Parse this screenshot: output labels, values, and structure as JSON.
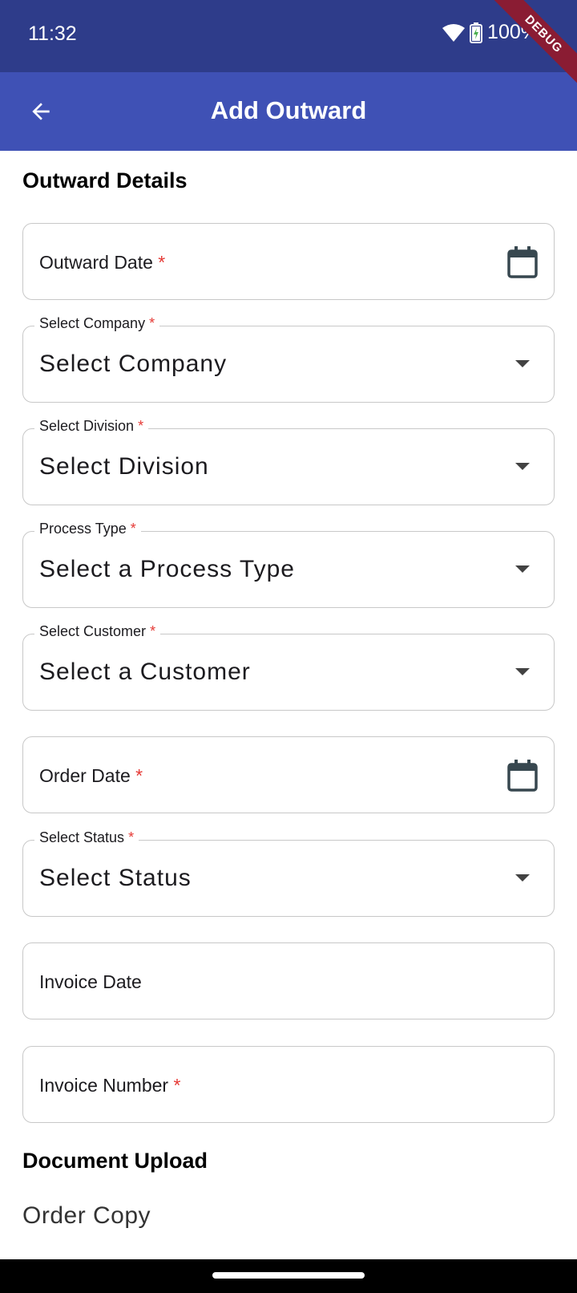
{
  "status_bar": {
    "time": "11:32",
    "battery": "100%"
  },
  "debug_ribbon": "DEBUG",
  "app_bar": {
    "title": "Add Outward"
  },
  "sections": {
    "outward_details": "Outward Details",
    "document_upload": "Document Upload"
  },
  "required_mark": "*",
  "fields": {
    "outward_date": {
      "label": "Outward Date"
    },
    "company": {
      "label": "Select Company",
      "placeholder": "Select Company"
    },
    "division": {
      "label": "Select Division",
      "placeholder": "Select Division"
    },
    "process_type": {
      "label": "Process Type",
      "placeholder": "Select a Process Type"
    },
    "customer": {
      "label": "Select Customer",
      "placeholder": "Select a Customer"
    },
    "order_date": {
      "label": "Order Date"
    },
    "status": {
      "label": "Select Status",
      "placeholder": "Select Status"
    },
    "invoice_date": {
      "label": "Invoice Date"
    },
    "invoice_number": {
      "label": "Invoice Number"
    }
  },
  "documents": {
    "order_copy": "Order Copy"
  },
  "colors": {
    "status_bar": "#2e3c8a",
    "app_bar": "#3f51b5",
    "required": "#e53935",
    "debug": "#8a1c33"
  }
}
